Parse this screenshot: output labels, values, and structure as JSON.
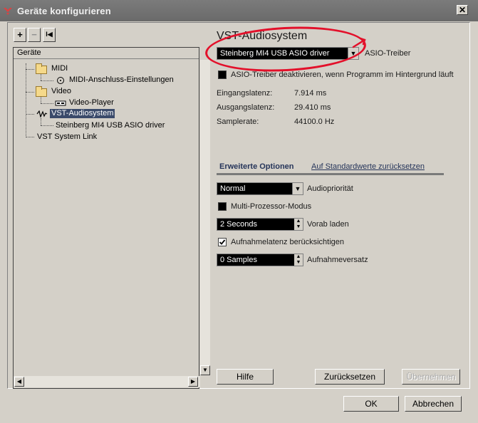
{
  "window": {
    "title": "Geräte konfigurieren",
    "close_glyph": "✕",
    "logo_icon": "cubase-logo-icon"
  },
  "toolbar": {
    "add_glyph": "+",
    "remove_glyph": "−",
    "reset_glyph": "I◀"
  },
  "tree": {
    "header": "Geräte",
    "items": [
      {
        "label": "MIDI",
        "icon": "folder-icon"
      },
      {
        "label": "MIDI-Anschluss-Einstellungen",
        "icon": "midi-port-icon"
      },
      {
        "label": "Video",
        "icon": "folder-icon"
      },
      {
        "label": "Video-Player",
        "icon": "video-player-icon"
      },
      {
        "label": "VST-Audiosystem",
        "icon": "vst-audio-icon"
      },
      {
        "label": "Steinberg MI4 USB ASIO driver",
        "icon": ""
      },
      {
        "label": "VST System Link",
        "icon": ""
      }
    ]
  },
  "panel": {
    "title": "VST-Audiosystem",
    "driver_combo": "Steinberg MI4 USB ASIO driver",
    "driver_label": "ASIO-Treiber",
    "deactivate_checkbox_label": "ASIO-Treiber deaktivieren, wenn Programm im Hintergrund läuft",
    "deactivate_checked": false,
    "stats": [
      {
        "label": "Eingangslatenz:",
        "value": "7.914 ms"
      },
      {
        "label": "Ausgangslatenz:",
        "value": "29.410 ms"
      },
      {
        "label": "Samplerate:",
        "value": "44100.0 Hz"
      }
    ],
    "advanced_options": "Erweiterte Optionen",
    "reset_defaults_link": "Auf Standardwerte zurücksetzen",
    "priority_combo": "Normal",
    "priority_label": "Audiopriorität",
    "multiprocessor_label": "Multi-Prozessor-Modus",
    "multiprocessor_checked": false,
    "preload_value": "2 Seconds",
    "preload_label": "Vorab laden",
    "record_latency_label": "Aufnahmelatenz berücksichtigen",
    "record_latency_checked": true,
    "record_offset_value": "0 Samples",
    "record_offset_label": "Aufnahmeversatz",
    "help_button": "Hilfe",
    "reset_button": "Zurücksetzen",
    "apply_button": "Übernehmen"
  },
  "footer": {
    "ok_button": "OK",
    "cancel_button": "Abbrechen"
  },
  "colors": {
    "annotation_red": "#e3102a",
    "selection": "#3a4a6a",
    "window_bg": "#d4d0c8"
  }
}
